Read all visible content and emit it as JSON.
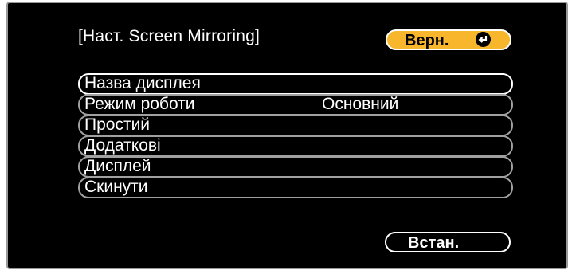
{
  "header": {
    "title": "[Наст. Screen Mirroring]",
    "back_label": "Верн.",
    "back_icon": "enter-icon",
    "back_color": "#f7b62c"
  },
  "menu": {
    "items": [
      {
        "label": "Назва дисплея",
        "value": ""
      },
      {
        "label": "Режим роботи",
        "value": "Основний"
      },
      {
        "label": "Простий",
        "value": ""
      },
      {
        "label": "Додаткові",
        "value": ""
      },
      {
        "label": "Дисплей",
        "value": ""
      },
      {
        "label": "Скинути",
        "value": ""
      }
    ]
  },
  "footer": {
    "set_label": "Встан."
  }
}
